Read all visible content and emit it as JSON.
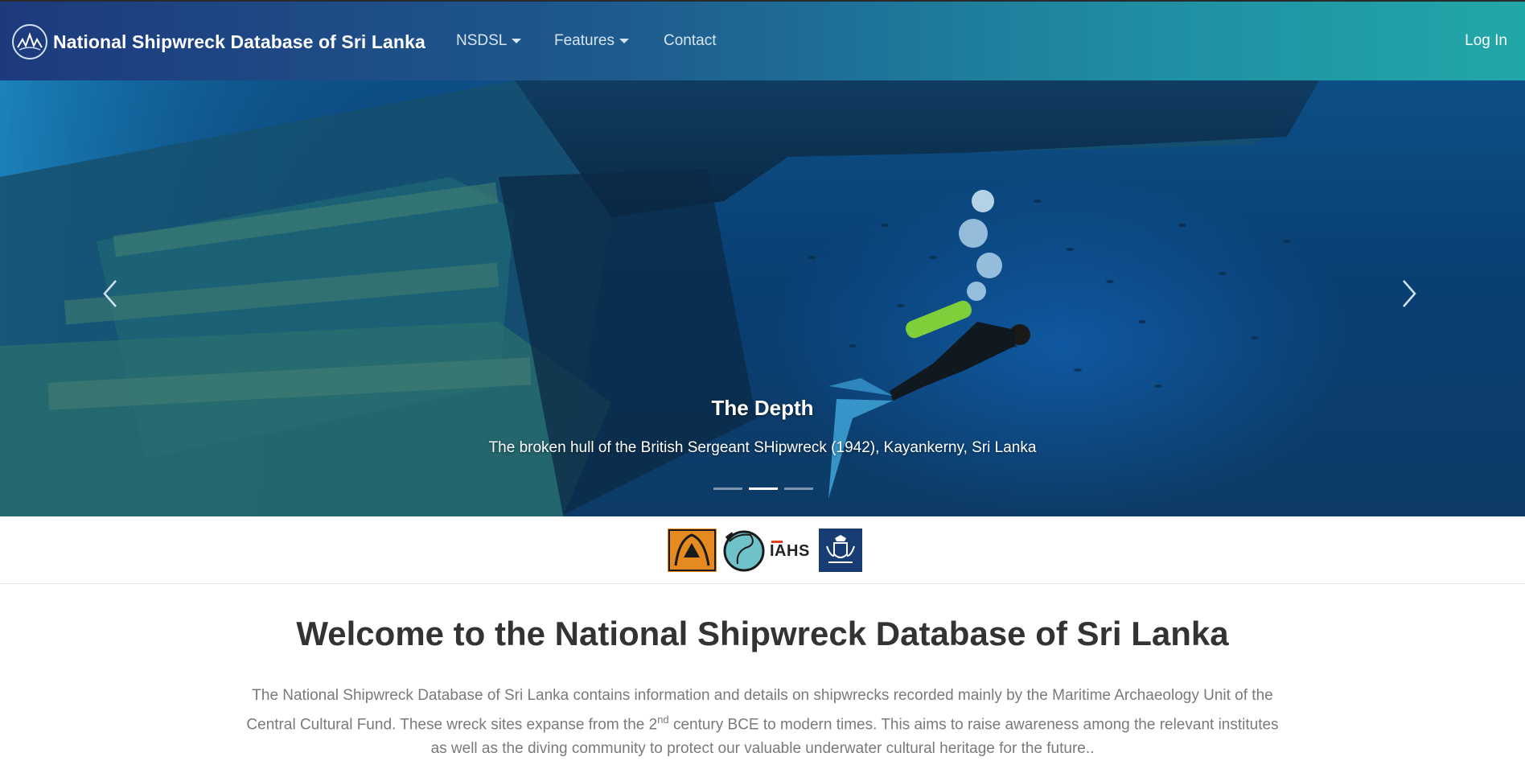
{
  "navbar": {
    "brand": "National Shipwreck Database of Sri Lanka",
    "items": [
      {
        "label": "NSDSL",
        "dropdown": true
      },
      {
        "label": "Features",
        "dropdown": true
      },
      {
        "label": "Contact",
        "dropdown": false
      }
    ],
    "login": "Log In"
  },
  "hero": {
    "slide_title": "The Depth",
    "slide_caption": "The broken hull of the British Sergeant SHipwreck (1942), Kayankerny, Sri Lanka",
    "slide_count": 3,
    "active_slide": 2,
    "prev_icon": "chevron-left-icon",
    "next_icon": "chevron-right-icon"
  },
  "partners": {
    "iahs_text": "IAHS"
  },
  "welcome": {
    "title": "Welcome to the National Shipwreck Database of Sri Lanka",
    "intro_1": "The National Shipwreck Database of Sri Lanka contains information and details on shipwrecks recorded mainly by the Maritime Archaeology Unit of the Central Cultural Fund. These wreck sites expanse from the 2",
    "intro_sup": "nd",
    "intro_2": " century BCE to modern times. This aims to raise awareness among the relevant institutes as well as the diving community to protect our valuable underwater cultural heritage for the future.."
  },
  "colors": {
    "nav_gradient_start": "#1d3a7d",
    "nav_gradient_end": "#22a7a8",
    "title_text": "#333333",
    "body_text": "#7a7a7a"
  }
}
